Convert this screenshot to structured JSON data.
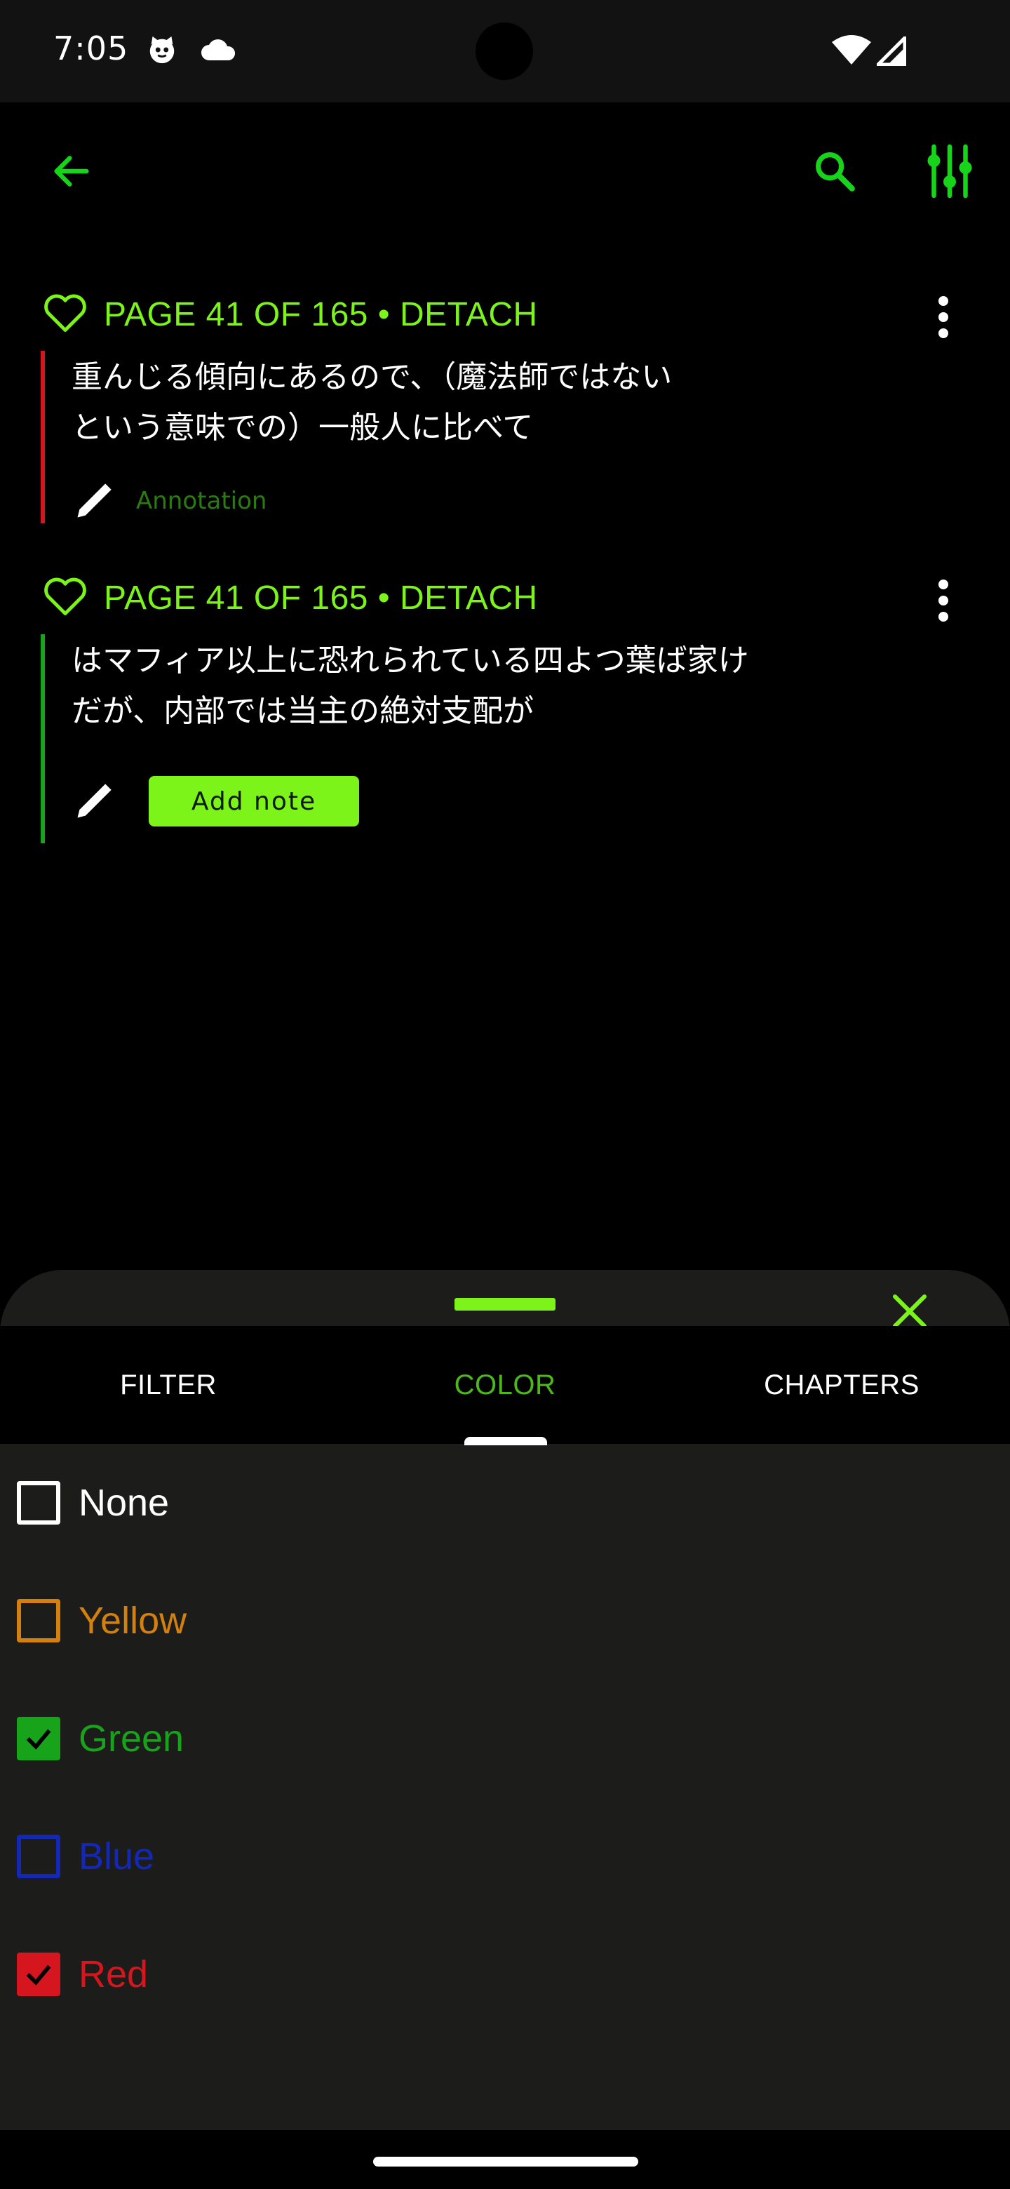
{
  "status_bar": {
    "time": "7:05"
  },
  "toolbar": {
    "back_icon": "arrow-left-icon",
    "search_icon": "search-icon",
    "filter_icon": "sliders-icon"
  },
  "highlights": [
    {
      "meta": "PAGE 41 OF 165 • DETACH",
      "text_line1": "重んじる傾向にあるので、（魔法師ではない",
      "text_line2": "という意味での）一般人に比べて",
      "annotation_placeholder": "Annotation",
      "bar_color": "#d6161e"
    },
    {
      "meta": "PAGE 41 OF 165 • DETACH",
      "text_line1": "はマフィア以上に恐れられている四よつ葉ば家け",
      "text_line2": "だが、内部では当主の絶対支配が",
      "add_note_label": "Add note",
      "bar_color": "#17a31a"
    }
  ],
  "sheet": {
    "tabs": [
      {
        "label": "FILTER",
        "active": false
      },
      {
        "label": "COLOR",
        "active": true
      },
      {
        "label": "CHAPTERS",
        "active": false
      }
    ],
    "options": [
      {
        "label": "None",
        "color": "#ffffff",
        "checked": false
      },
      {
        "label": "Yellow",
        "color": "#d4800e",
        "checked": false
      },
      {
        "label": "Green",
        "color": "#17a31a",
        "checked": true
      },
      {
        "label": "Blue",
        "color": "#1428b8",
        "checked": false
      },
      {
        "label": "Red",
        "color": "#d6161e",
        "checked": true
      }
    ]
  },
  "colors": {
    "accent": "#7cf41a",
    "sheet_bg": "#1c1d1b"
  }
}
